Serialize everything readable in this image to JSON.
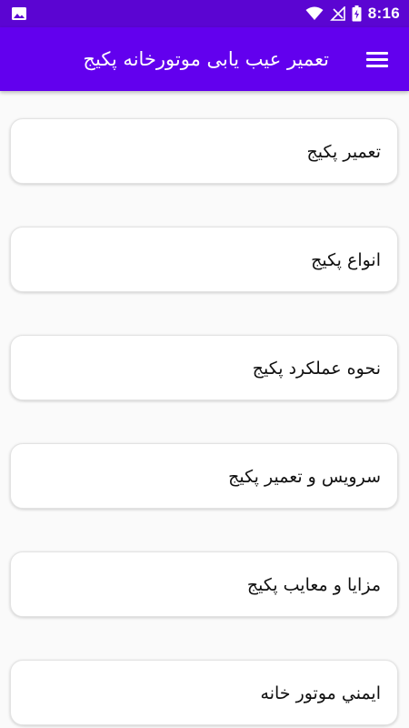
{
  "status_bar": {
    "time": "8:16",
    "icons": [
      "image-icon",
      "wifi-icon",
      "signal-icon",
      "battery-icon"
    ],
    "background_color": "#5b05d2"
  },
  "app_bar": {
    "title": "تعمیر عیب یابی موتورخانه پکیج",
    "menu_icon": "menu-icon",
    "background_color": "#6200ee"
  },
  "menu_items": [
    {
      "label": "تعمیر پکیج"
    },
    {
      "label": "انواع پکیج"
    },
    {
      "label": "نحوه عملکرد پکیج"
    },
    {
      "label": "سرویس و تعمیر پکیج"
    },
    {
      "label": "مزایا و معایب پکیج"
    },
    {
      "label": "ایمني موتور خانه"
    }
  ]
}
